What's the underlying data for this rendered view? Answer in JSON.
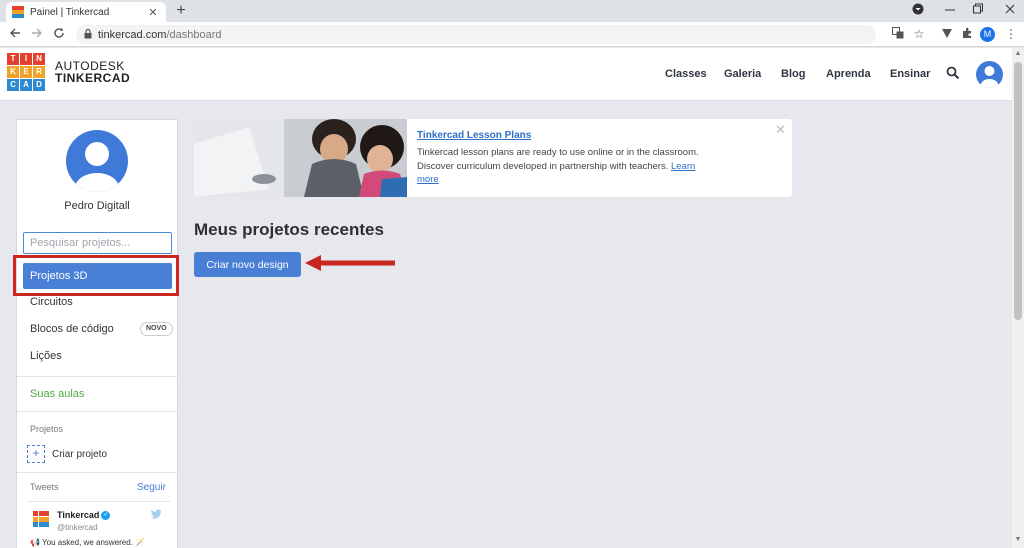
{
  "browser": {
    "tab_title": "Painel | Tinkercad",
    "tab_close": "✕",
    "new_tab": "+",
    "url_host": "tinkercad.com",
    "url_path": "/dashboard",
    "profile_letter": "M"
  },
  "header": {
    "brand_top": "AUTODESK",
    "brand_bottom": "TINKERCAD",
    "logo_letters": [
      "T",
      "I",
      "N",
      "K",
      "E",
      "R",
      "C",
      "A",
      "D"
    ],
    "nav": [
      "Classes",
      "Galeria",
      "Blog",
      "Aprenda",
      "Ensinar"
    ]
  },
  "sidebar": {
    "username": "Pedro Digitall",
    "search_placeholder": "Pesquisar projetos...",
    "items": [
      {
        "label": "Projetos 3D"
      },
      {
        "label": "Circuitos"
      },
      {
        "label": "Blocos de código",
        "badge": "NOVO"
      },
      {
        "label": "Lições"
      }
    ],
    "classes_link": "Suas aulas",
    "projects_section": "Projetos",
    "create_project": "Criar projeto",
    "tweets_section": "Tweets",
    "follow": "Seguir",
    "tweet": {
      "name": "Tinkercad",
      "handle": "@tinkercad",
      "text": "📢 You asked, we answered. 🪄"
    }
  },
  "banner": {
    "title": "Tinkercad Lesson Plans",
    "text": "Tinkercad lesson plans are ready to use online or in the classroom. Discover curriculum developed in partnership with teachers.",
    "link": "Learn more",
    "close": "✕"
  },
  "main": {
    "title": "Meus projetos recentes",
    "create_button": "Criar novo design"
  },
  "colors": {
    "accent": "#4a7fd6",
    "annotation": "#c8281f",
    "logo": [
      "#e2412f",
      "#e2412f",
      "#e2412f",
      "#f2a228",
      "#f2a228",
      "#f2a228",
      "#2c8ad1",
      "#2c8ad1",
      "#2c8ad1"
    ]
  }
}
